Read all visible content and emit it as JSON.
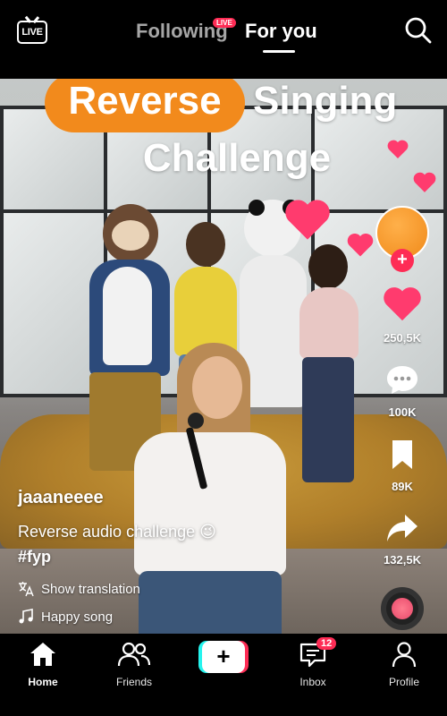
{
  "header": {
    "live_label": "LIVE",
    "tabs": [
      {
        "label": "Following",
        "badge": "LIVE"
      },
      {
        "label": "For you",
        "active": true
      }
    ]
  },
  "video": {
    "title_highlight": "Reverse",
    "title_rest": "Singing",
    "title_line2": "Challenge",
    "highlight_color": "#f28a1c"
  },
  "actions": {
    "likes": "250,5K",
    "comments": "100K",
    "saves": "89K",
    "shares": "132,5K"
  },
  "post": {
    "username": "jaaaneeee",
    "description": "Reverse audio challenge 😉",
    "hashtag": "#fyp",
    "translate_label": "Show translation",
    "song": "Happy song"
  },
  "nav": {
    "items": [
      {
        "label": "Home",
        "icon": "home-icon",
        "active": true
      },
      {
        "label": "Friends",
        "icon": "friends-icon"
      },
      {
        "label": "",
        "icon": "plus-icon"
      },
      {
        "label": "Inbox",
        "icon": "inbox-icon",
        "badge": "12"
      },
      {
        "label": "Profile",
        "icon": "profile-icon"
      }
    ]
  },
  "colors": {
    "accent_red": "#fe2c55",
    "accent_cyan": "#25f4ee",
    "heart_pink": "#ff3b6e"
  }
}
